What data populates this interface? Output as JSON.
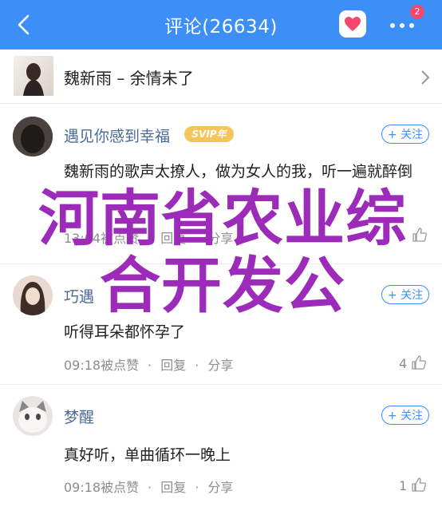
{
  "header": {
    "title": "评论(26634)",
    "badge_count": "2"
  },
  "song": {
    "text": "魏新雨 – 余情未了"
  },
  "comments": [
    {
      "name": "遇见你感到幸福",
      "vip": "SVIP年",
      "follow": "+ 关注",
      "text": "魏新雨的歌声太撩人，做为女人的我，听一遍就醉倒",
      "time": "13:04被点赞",
      "reply": "回复",
      "share": "分享",
      "likes": ""
    },
    {
      "name": "巧遇",
      "follow": "+ 关注",
      "text": "听得耳朵都怀孕了",
      "time": "09:18被点赞",
      "reply": "回复",
      "share": "分享",
      "likes": "4"
    },
    {
      "name": "梦醒",
      "follow": "+ 关注",
      "text": "真好听，单曲循环一晚上",
      "time": "09:18被点赞",
      "reply": "回复",
      "share": "分享",
      "likes": "1"
    }
  ],
  "watermark": {
    "line1": "河南省农业综",
    "line2": "合开发公"
  }
}
